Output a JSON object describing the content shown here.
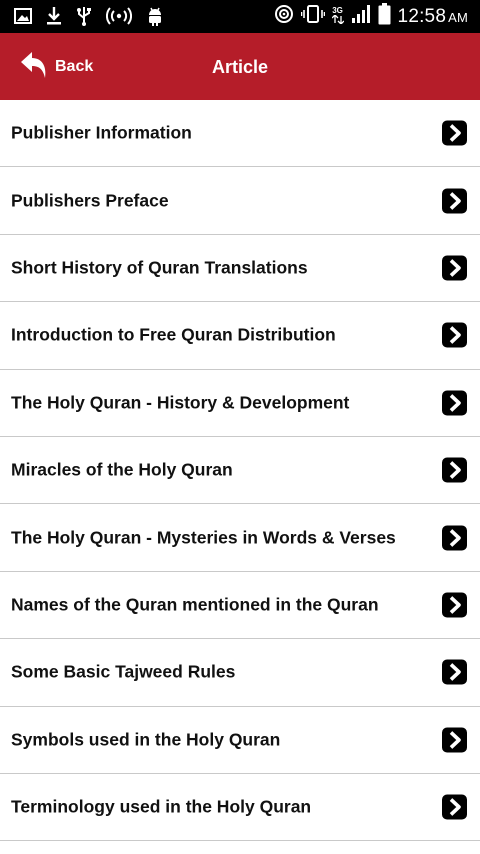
{
  "status_bar": {
    "time": "12:58",
    "ampm": "AM",
    "network": "3G",
    "icons": [
      "image-icon",
      "download-icon",
      "usb-icon",
      "hotspot-icon",
      "android-icon",
      "location-icon",
      "vibrate-icon",
      "signal-icon",
      "battery-icon"
    ]
  },
  "app_bar": {
    "back_label": "Back",
    "title": "Article",
    "color": "#b51d29"
  },
  "articles": [
    {
      "label": "Publisher Information"
    },
    {
      "label": "Publishers Preface"
    },
    {
      "label": "Short History of Quran Translations"
    },
    {
      "label": "Introduction to Free Quran Distribution"
    },
    {
      "label": "The Holy Quran - History & Development"
    },
    {
      "label": "Miracles of the Holy Quran"
    },
    {
      "label": "The Holy Quran - Mysteries in Words & Verses"
    },
    {
      "label": "Names of the Quran mentioned in the Quran"
    },
    {
      "label": "Some Basic Tajweed Rules"
    },
    {
      "label": "Symbols used in the Holy Quran"
    },
    {
      "label": "Terminology used in the Holy Quran"
    }
  ]
}
